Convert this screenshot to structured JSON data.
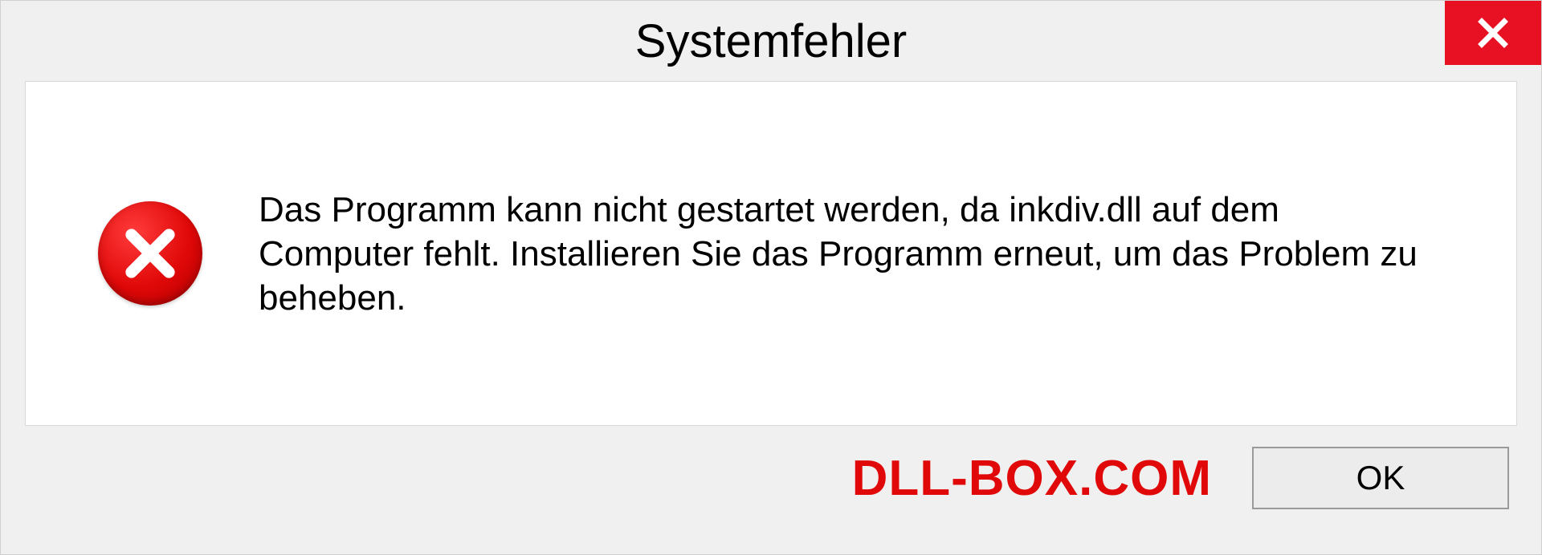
{
  "dialog": {
    "title": "Systemfehler",
    "message": "Das Programm kann nicht gestartet werden, da inkdiv.dll auf dem Computer fehlt. Installieren Sie das Programm erneut, um das Problem zu beheben.",
    "ok_label": "OK"
  },
  "watermark": "DLL-BOX.COM",
  "colors": {
    "close_bg": "#e81123",
    "error_red": "#e00808",
    "panel_bg": "#f0f0f0"
  }
}
